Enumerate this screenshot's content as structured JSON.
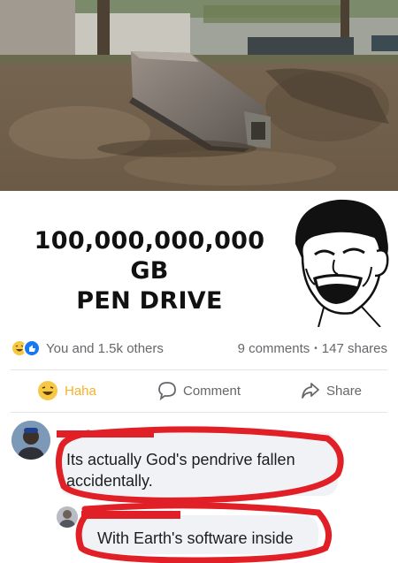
{
  "meme": {
    "line1": "100,000,000,000 GB",
    "line2": "PEN DRIVE"
  },
  "reactions": {
    "summary": "You and 1.5k others",
    "comments": "9 comments",
    "separator": "•",
    "shares": "147 shares"
  },
  "actions": {
    "haha_label": "Haha",
    "comment_label": "Comment",
    "share_label": "Share"
  },
  "comments": [
    {
      "text": "Its actually God's pendrive fallen accidentally."
    },
    {
      "text": "With Earth's software inside"
    }
  ],
  "colors": {
    "haha": "#f7b125",
    "like_blue": "#1877f2",
    "secondary_text": "#65676b",
    "bubble": "#f0f2f5",
    "scribble_red": "#e01f26"
  },
  "icons": [
    "haha-reaction-icon",
    "like-reaction-icon",
    "comment-icon",
    "share-icon",
    "laughing-meme-face"
  ]
}
